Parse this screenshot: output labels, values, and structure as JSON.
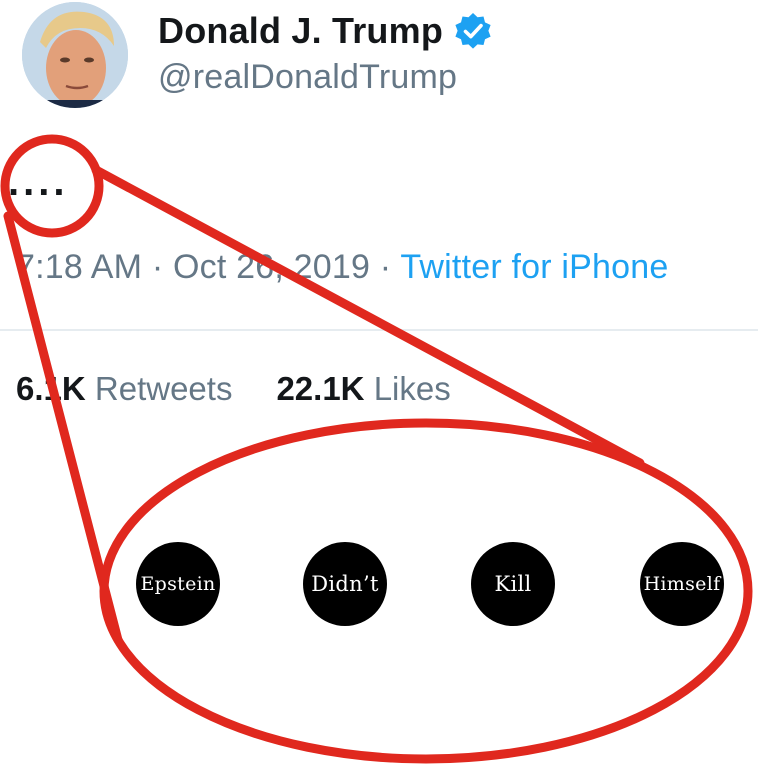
{
  "user": {
    "display_name": "Donald J. Trump",
    "handle": "@realDonaldTrump",
    "verified": true,
    "avatar_icon": "profile-photo"
  },
  "tweet": {
    "text": "....",
    "time": "7:18 AM",
    "separator": "·",
    "date": "Oct 26, 2019",
    "source": "Twitter for iPhone"
  },
  "stats": {
    "retweets_count": "6.1K",
    "retweets_label": "Retweets",
    "likes_count": "22.1K",
    "likes_label": "Likes"
  },
  "annotation": {
    "words": [
      "Epstein",
      "Didn’t",
      "Kill",
      "Himself"
    ],
    "outline_color": "#e0281e",
    "dot_color": "#000000"
  },
  "colors": {
    "verified_blue": "#1da1f2",
    "muted_text": "#657786",
    "primary_text": "#14171a"
  }
}
